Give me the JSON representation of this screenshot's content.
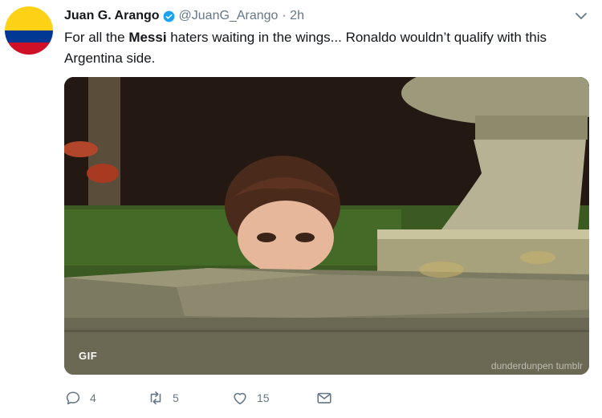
{
  "tweet": {
    "author_name": "Juan G. Arango",
    "handle": "@JuanG_Arango",
    "time": "· 2h",
    "text_before": "For all the ",
    "text_bold": "Messi",
    "text_after": " haters waiting in the wings... Ronaldo wouldn’t qualify with this Argentina side."
  },
  "media": {
    "badge": "GIF",
    "watermark": "dunderdunpen tumblr"
  },
  "actions": {
    "reply_count": "4",
    "retweet_count": "5",
    "like_count": "15"
  },
  "icons": {
    "avatar": "colombia-flag-avatar",
    "verified": "verified-badge-icon",
    "caret": "chevron-down-icon",
    "reply": "reply-icon",
    "retweet": "retweet-icon",
    "like": "heart-icon",
    "dm": "envelope-icon"
  },
  "colors": {
    "verified": "#1da1f2",
    "muted": "#657786",
    "flag_yellow": "#fcd116",
    "flag_blue": "#003893",
    "flag_red": "#ce1126"
  }
}
